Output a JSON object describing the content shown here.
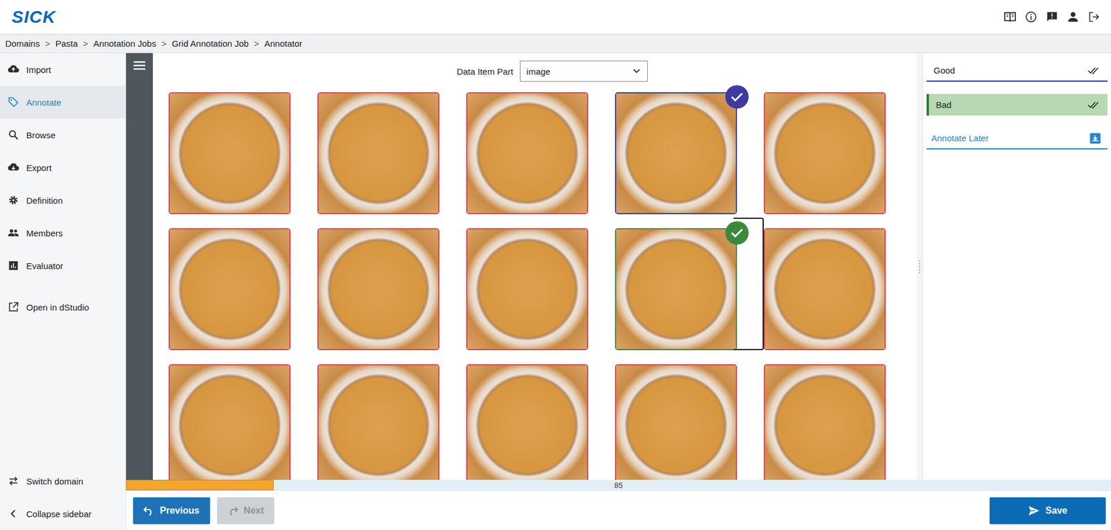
{
  "logo": "SICK",
  "breadcrumb": {
    "items": [
      "Domains",
      "Pasta",
      "Annotation Jobs",
      "Grid Annotation Job",
      "Annotator"
    ],
    "separator": ">"
  },
  "sidebar": {
    "items": [
      {
        "label": "Import",
        "selected": false
      },
      {
        "label": "Annotate",
        "selected": true
      },
      {
        "label": "Browse",
        "selected": false
      },
      {
        "label": "Export",
        "selected": false
      },
      {
        "label": "Definition",
        "selected": false
      },
      {
        "label": "Members",
        "selected": false
      },
      {
        "label": "Evaluator",
        "selected": false
      },
      {
        "label": "Open in dStudio",
        "selected": false
      }
    ],
    "footer": [
      {
        "label": "Switch domain"
      },
      {
        "label": "Collapse sidebar"
      }
    ]
  },
  "data_item_part": {
    "label": "Data Item Part",
    "value": "image"
  },
  "tiles": [
    {
      "color": "#e0434f",
      "checked": false,
      "focused": false
    },
    {
      "color": "#e0434f",
      "checked": false,
      "focused": false
    },
    {
      "color": "#e0434f",
      "checked": false,
      "focused": false
    },
    {
      "color": "#3f3a9e",
      "checked": true,
      "focused": false
    },
    {
      "color": "#e0434f",
      "checked": false,
      "focused": false
    },
    {
      "color": "#e0434f",
      "checked": false,
      "focused": false
    },
    {
      "color": "#e0434f",
      "checked": false,
      "focused": false
    },
    {
      "color": "#e0434f",
      "checked": false,
      "focused": false
    },
    {
      "color": "#3a8a3e",
      "checked": true,
      "focused": true
    },
    {
      "color": "#e0434f",
      "checked": false,
      "focused": false
    },
    {
      "color": "#e0434f",
      "checked": false,
      "focused": false
    },
    {
      "color": "#e0434f",
      "checked": false,
      "focused": false
    },
    {
      "color": "#e0434f",
      "checked": false,
      "focused": false
    },
    {
      "color": "#e0434f",
      "checked": false,
      "focused": false
    },
    {
      "color": "#e0434f",
      "checked": false,
      "focused": false
    }
  ],
  "labels": [
    {
      "label": "Good",
      "selected": false,
      "kind": "class"
    },
    {
      "label": "Bad",
      "selected": true,
      "kind": "class"
    },
    {
      "label": "Annotate Later",
      "selected": false,
      "kind": "action"
    }
  ],
  "progress": {
    "level": 0.15,
    "reading": "85"
  },
  "buttons": [
    {
      "label": "Previous",
      "disabled": false
    },
    {
      "label": "Next",
      "disabled": true
    },
    {
      "label": "Save",
      "disabled": false
    }
  ]
}
